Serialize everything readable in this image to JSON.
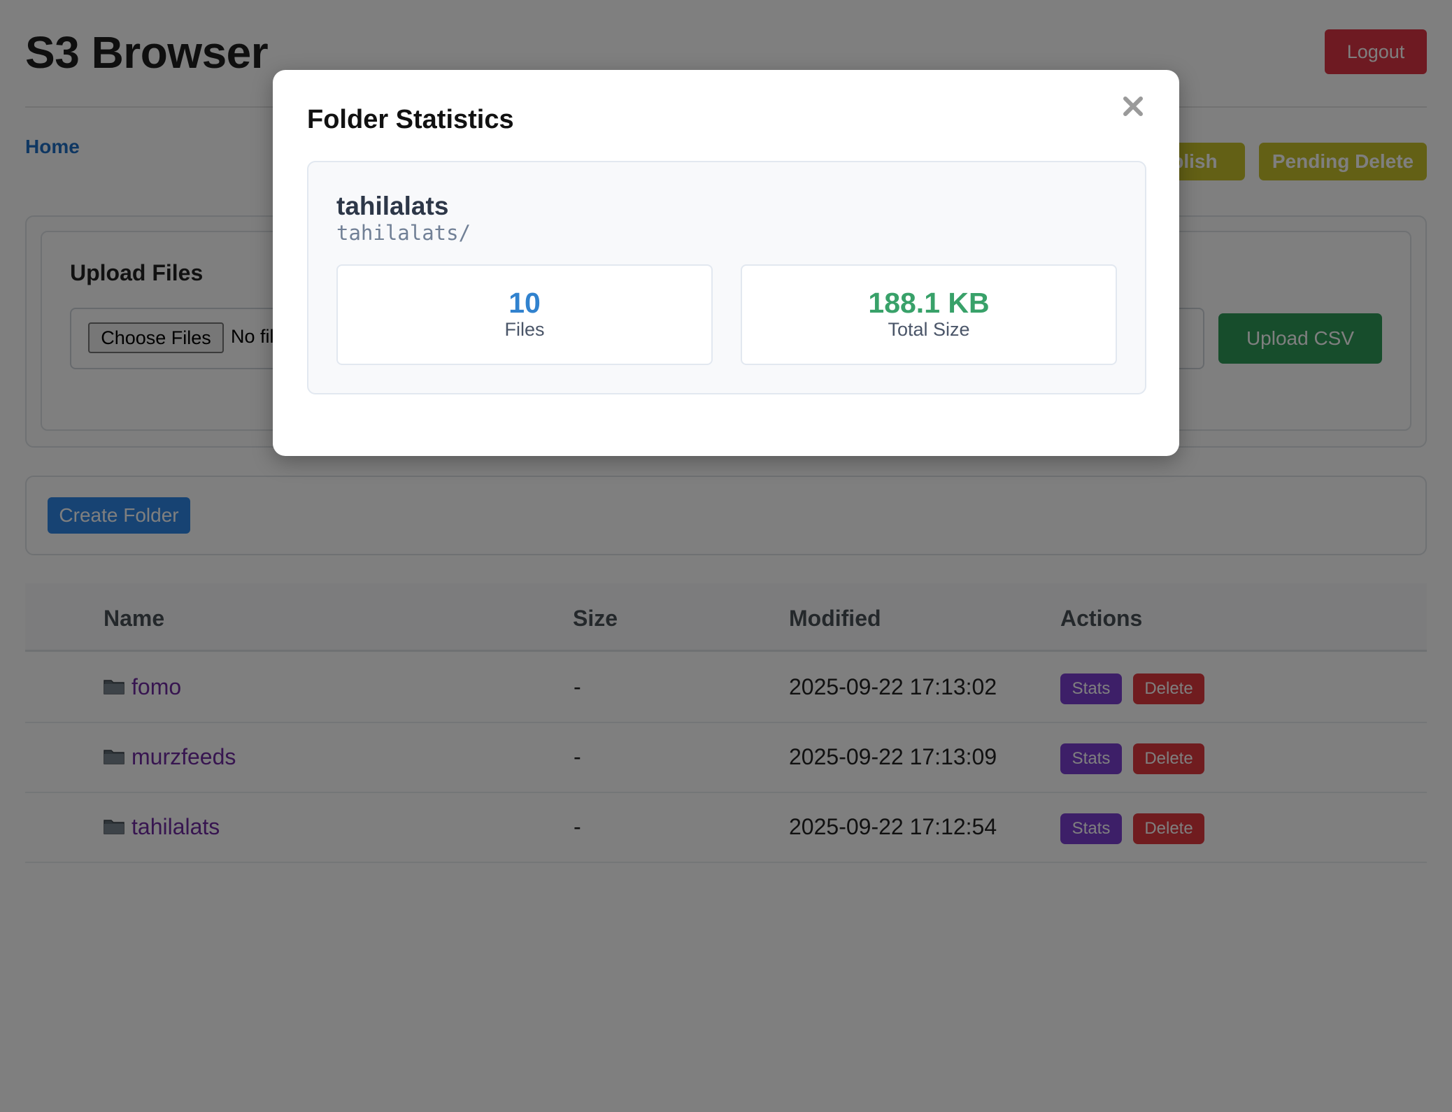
{
  "app": {
    "title": "S3 Browser",
    "logout_label": "Logout"
  },
  "nav": {
    "breadcrumb_home": "Home",
    "publish_label": "Publish",
    "pending_delete_label": "Pending Delete"
  },
  "upload": {
    "title": "Upload Files",
    "choose_label": "Choose Files",
    "no_file_text": "No file chosen",
    "upload_csv_label": "Upload CSV"
  },
  "folder_actions": {
    "create_folder_label": "Create Folder"
  },
  "table": {
    "headers": {
      "name": "Name",
      "size": "Size",
      "modified": "Modified",
      "actions": "Actions"
    },
    "rows": [
      {
        "name": "fomo",
        "size": "-",
        "modified": "2025-09-22 17:13:02",
        "stats_label": "Stats",
        "delete_label": "Delete"
      },
      {
        "name": "murzfeeds",
        "size": "-",
        "modified": "2025-09-22 17:13:09",
        "stats_label": "Stats",
        "delete_label": "Delete"
      },
      {
        "name": "tahilalats",
        "size": "-",
        "modified": "2025-09-22 17:12:54",
        "stats_label": "Stats",
        "delete_label": "Delete"
      }
    ]
  },
  "modal": {
    "title": "Folder Statistics",
    "folder_name": "tahilalats",
    "folder_path": "tahilalats/",
    "files_value": "10",
    "files_label": "Files",
    "size_value": "188.1 KB",
    "size_label": "Total Size"
  },
  "colors": {
    "files_value": "#3182ce",
    "size_value": "#38a169",
    "danger": "#dc3545",
    "stats": "#7b3fd1",
    "link": "#1f6fc5"
  },
  "icons": {
    "folder": "folder-icon",
    "close": "close-icon"
  }
}
